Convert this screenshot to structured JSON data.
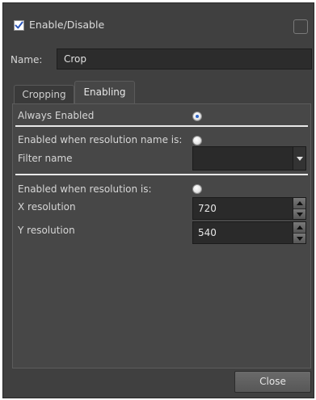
{
  "header": {
    "enable_label": "Enable/Disable",
    "enable_checked": true
  },
  "name_row": {
    "label": "Name:",
    "value": "Crop"
  },
  "tabs": [
    {
      "label": "Cropping",
      "active": false
    },
    {
      "label": "Enabling",
      "active": true
    }
  ],
  "enabling": {
    "always_enabled_label": "Always Enabled",
    "always_enabled_selected": true,
    "res_name_label": "Enabled when resolution name is:",
    "res_name_selected": false,
    "filter_name_label": "Filter name",
    "filter_name_value": "",
    "res_label": "Enabled when resolution is:",
    "res_selected": false,
    "x_res_label": "X resolution",
    "x_res_value": "720",
    "y_res_label": "Y resolution",
    "y_res_value": "540"
  },
  "footer": {
    "close_label": "Close"
  },
  "colors": {
    "background": "#404040",
    "panel": "#474747",
    "field": "#2a2a2a",
    "radio_dot": "#2f66c9"
  }
}
